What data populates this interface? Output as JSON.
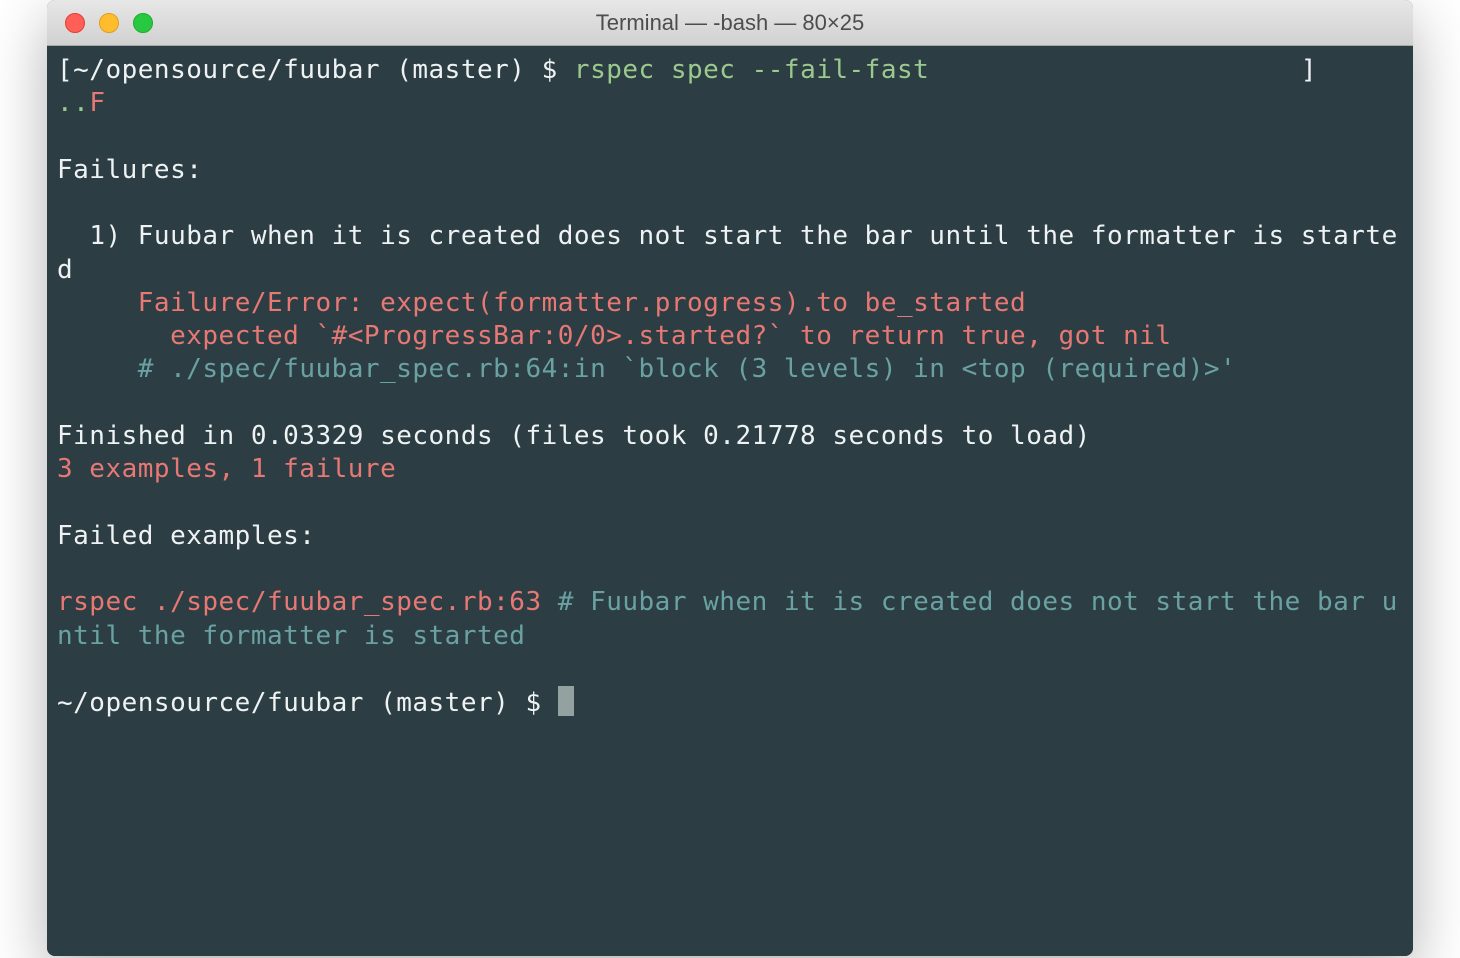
{
  "titlebar": {
    "title": "Terminal — -bash — 80×25"
  },
  "colors": {
    "bg": "#2c3e44",
    "fg": "#eef2f3",
    "green": "#9bc98e",
    "red": "#e77874",
    "cyan": "#6aa2a3"
  },
  "lines": {
    "l1_bracket_open": "[",
    "l1_prompt": "~/opensource/fuubar (master) $ ",
    "l1_cmd": "rspec spec --fail-fast",
    "l1_bracket_close_pad": "                       ]",
    "l2_dots": "..",
    "l2_F": "F",
    "l3_blank": " ",
    "l4": "Failures:",
    "l5_blank": " ",
    "l6": "  1) Fuubar when it is created does not start the bar until the formatter is started",
    "l7": "     Failure/Error: expect(formatter.progress).to be_started",
    "l8": "       expected `#<ProgressBar:0/0>.started?` to return true, got nil",
    "l9": "     # ./spec/fuubar_spec.rb:64:in `block (3 levels) in <top (required)>'",
    "l10_blank": " ",
    "l11": "Finished in 0.03329 seconds (files took 0.21778 seconds to load)",
    "l12": "3 examples, 1 failure",
    "l13_blank": " ",
    "l14": "Failed examples:",
    "l15_blank": " ",
    "l16_red": "rspec ./spec/fuubar_spec.rb:63",
    "l16_cyan": " # Fuubar when it is created does not start the bar until the formatter is started",
    "l17_blank": " ",
    "l18_prompt": "~/opensource/fuubar (master) $ "
  }
}
